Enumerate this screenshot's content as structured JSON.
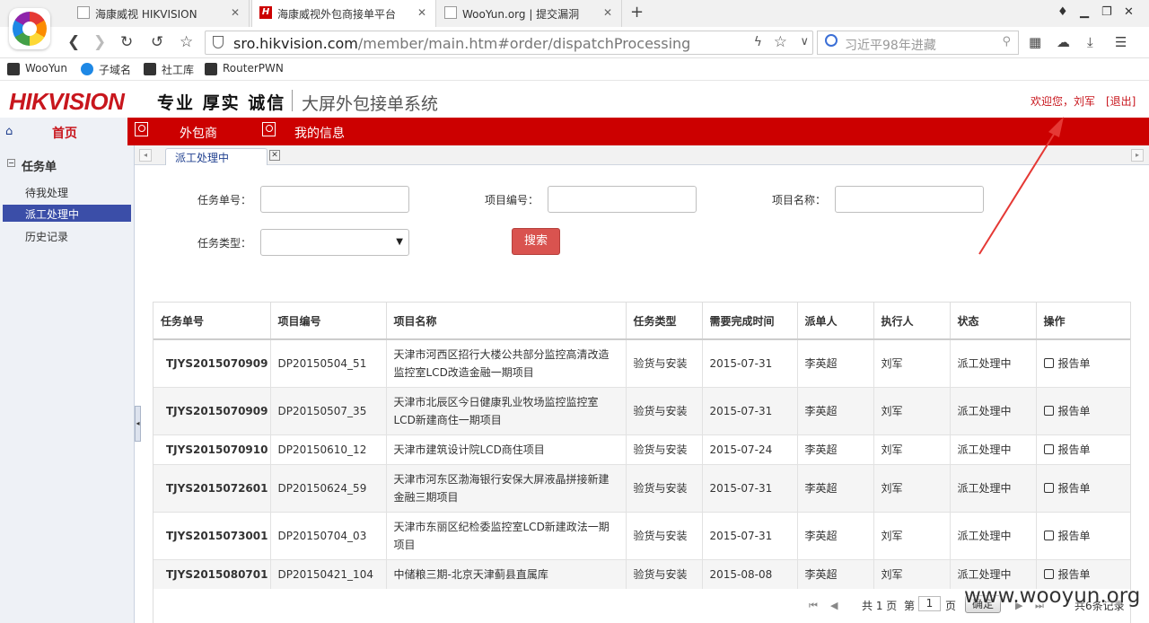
{
  "browser": {
    "tabs": [
      {
        "title": "海康威视 HIKVISION",
        "active": false
      },
      {
        "title": "海康威视外包商接单平台",
        "active": true
      },
      {
        "title": "WooYun.org | 提交漏洞",
        "active": false
      }
    ],
    "url_host": "sro.hikvision.com",
    "url_path": "/member/main.htm#order/dispatchProcessing",
    "search_placeholder": "习近平98年进藏",
    "bookmarks": [
      "WooYun",
      "子域名",
      "社工库",
      "RouterPWN"
    ]
  },
  "header": {
    "logo": "HIKVISION",
    "slogan": "专业 厚实 诚信",
    "system_name": "大屏外包接单系统",
    "welcome": "欢迎您，刘军",
    "logout": "[退出]"
  },
  "topnav": {
    "home": "首页",
    "items": [
      "外包商",
      "我的信息"
    ]
  },
  "sidebar": {
    "section": "任务单",
    "items": [
      {
        "label": "待我处理",
        "active": false
      },
      {
        "label": "派工处理中",
        "active": true
      },
      {
        "label": "历史记录",
        "active": false
      }
    ]
  },
  "content_tab": {
    "label": "派工处理中"
  },
  "search_form": {
    "task_no_label": "任务单号：",
    "project_no_label": "项目编号：",
    "project_name_label": "项目名称：",
    "task_type_label": "任务类型：",
    "search_button": "搜索"
  },
  "table": {
    "columns": [
      "任务单号",
      "项目编号",
      "项目名称",
      "任务类型",
      "需要完成时间",
      "派单人",
      "执行人",
      "状态",
      "操作"
    ],
    "action_label": "报告单",
    "rows": [
      {
        "task_no": "TJYS2015070909",
        "project_no": "DP20150504_51",
        "project_name": "天津市河西区招行大楼公共部分监控高清改造监控室LCD改造金融一期项目",
        "task_type": "验货与安装",
        "due": "2015-07-31",
        "dispatcher": "李英超",
        "executor": "刘军",
        "status": "派工处理中"
      },
      {
        "task_no": "TJYS2015070909",
        "project_no": "DP20150507_35",
        "project_name": "天津市北辰区今日健康乳业牧场监控监控室LCD新建商住一期项目",
        "task_type": "验货与安装",
        "due": "2015-07-31",
        "dispatcher": "李英超",
        "executor": "刘军",
        "status": "派工处理中"
      },
      {
        "task_no": "TJYS2015070910",
        "project_no": "DP20150610_12",
        "project_name": "天津市建筑设计院LCD商住项目",
        "task_type": "验货与安装",
        "due": "2015-07-24",
        "dispatcher": "李英超",
        "executor": "刘军",
        "status": "派工处理中"
      },
      {
        "task_no": "TJYS2015072601",
        "project_no": "DP20150624_59",
        "project_name": "天津市河东区渤海银行安保大屏液晶拼接新建金融三期项目",
        "task_type": "验货与安装",
        "due": "2015-07-31",
        "dispatcher": "李英超",
        "executor": "刘军",
        "status": "派工处理中"
      },
      {
        "task_no": "TJYS2015073001",
        "project_no": "DP20150704_03",
        "project_name": "天津市东丽区纪检委监控室LCD新建政法一期项目",
        "task_type": "验货与安装",
        "due": "2015-07-31",
        "dispatcher": "李英超",
        "executor": "刘军",
        "status": "派工处理中"
      },
      {
        "task_no": "TJYS2015080701",
        "project_no": "DP20150421_104",
        "project_name": "中储粮三期-北京天津蓟县直属库",
        "task_type": "验货与安装",
        "due": "2015-08-08",
        "dispatcher": "李英超",
        "executor": "刘军",
        "status": "派工处理中"
      }
    ]
  },
  "pager": {
    "total_pages": "共 1 页",
    "page_prefix": "第",
    "page_value": "1",
    "page_suffix": "页",
    "confirm": "确定",
    "total_records": "共6条记录"
  },
  "watermark": "www.wooyun.org",
  "colors": {
    "brand_red": "#c00",
    "active_blue": "#3b4ea8",
    "search_button": "#d9534f",
    "annotation_arrow": "#e53935"
  }
}
